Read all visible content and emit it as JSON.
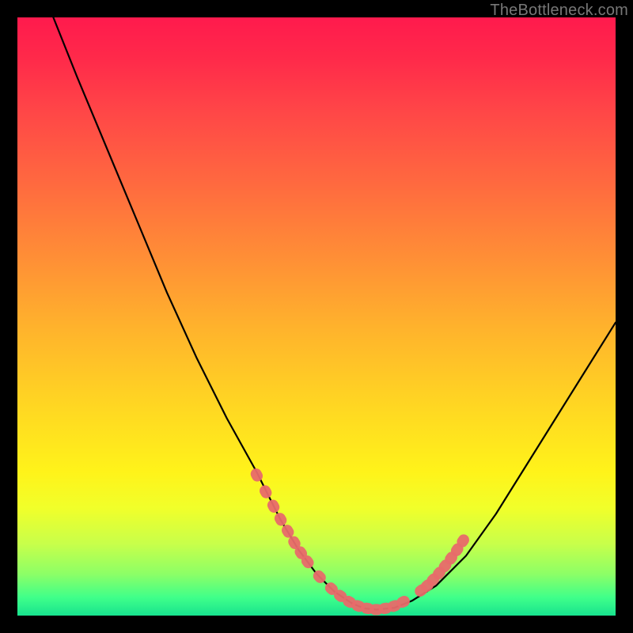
{
  "watermark": "TheBottleneck.com",
  "colors": {
    "pellet": "#e86a6a",
    "curve": "#000000",
    "frame_bg_top": "#ff1a4d",
    "frame_bg_bottom": "#18e38e",
    "page_bg": "#000000"
  },
  "chart_data": {
    "type": "line",
    "title": "",
    "xlabel": "",
    "ylabel": "",
    "xlim": [
      0,
      100
    ],
    "ylim": [
      0,
      100
    ],
    "grid": false,
    "legend": false,
    "series": [
      {
        "name": "bottleneck-curve",
        "x": [
          6,
          10,
          15,
          20,
          25,
          30,
          35,
          40,
          44,
          47,
          50,
          53,
          56,
          58,
          60,
          63,
          66,
          70,
          75,
          80,
          85,
          90,
          95,
          100
        ],
        "y": [
          100,
          90,
          78,
          66,
          54,
          43,
          33,
          24,
          16,
          11,
          7,
          4,
          2,
          1.2,
          1,
          1.3,
          2.5,
          5,
          10,
          17,
          25,
          33,
          41,
          49
        ]
      }
    ],
    "annotations": {
      "pellet_clusters": [
        {
          "name": "left-arm-dots",
          "points_xy": [
            [
              40.0,
              23.5
            ],
            [
              41.5,
              20.7
            ],
            [
              42.8,
              18.3
            ],
            [
              44.0,
              16.1
            ],
            [
              45.2,
              14.1
            ],
            [
              46.3,
              12.2
            ],
            [
              47.4,
              10.5
            ],
            [
              48.5,
              9.0
            ]
          ]
        },
        {
          "name": "valley-dots",
          "points_xy": [
            [
              50.5,
              6.5
            ],
            [
              52.5,
              4.5
            ],
            [
              54.0,
              3.3
            ],
            [
              55.5,
              2.3
            ],
            [
              57.0,
              1.6
            ],
            [
              58.5,
              1.2
            ],
            [
              60.0,
              1.0
            ],
            [
              61.5,
              1.2
            ],
            [
              63.0,
              1.6
            ],
            [
              64.5,
              2.3
            ]
          ]
        },
        {
          "name": "right-arm-dots",
          "points_xy": [
            [
              67.5,
              4.2
            ],
            [
              68.5,
              5.0
            ],
            [
              69.5,
              6.0
            ],
            [
              70.5,
              7.1
            ],
            [
              71.5,
              8.3
            ],
            [
              72.5,
              9.6
            ],
            [
              73.5,
              11.0
            ],
            [
              74.5,
              12.5
            ]
          ]
        }
      ],
      "pellet_radius_px": 7
    }
  }
}
